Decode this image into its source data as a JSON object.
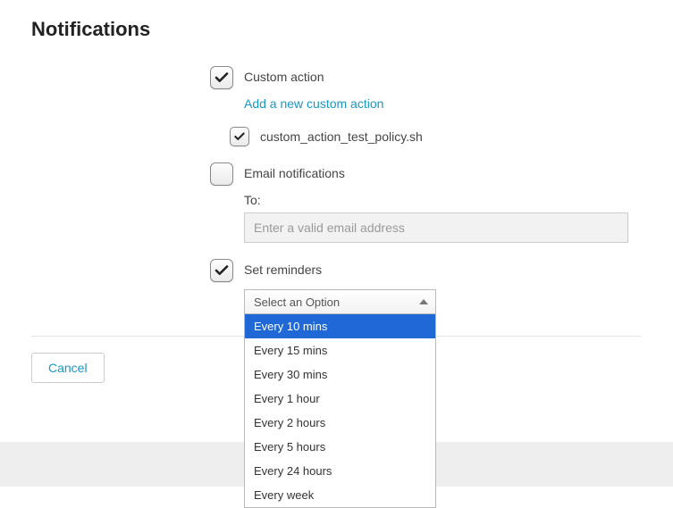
{
  "title": "Notifications",
  "custom_action": {
    "label": "Custom action",
    "checked": true,
    "add_link": "Add a new custom action",
    "items": [
      {
        "label": "custom_action_test_policy.sh",
        "checked": true
      }
    ]
  },
  "email": {
    "label": "Email notifications",
    "checked": false,
    "to_label": "To:",
    "placeholder": "Enter a valid email address",
    "value": ""
  },
  "reminders": {
    "label": "Set reminders",
    "checked": true,
    "select_placeholder": "Select an Option",
    "highlighted_index": 0,
    "options": [
      "Every 10 mins",
      "Every 15 mins",
      "Every 30 mins",
      "Every 1 hour",
      "Every 2 hours",
      "Every 5 hours",
      "Every 24 hours",
      "Every week"
    ]
  },
  "buttons": {
    "cancel": "Cancel"
  }
}
